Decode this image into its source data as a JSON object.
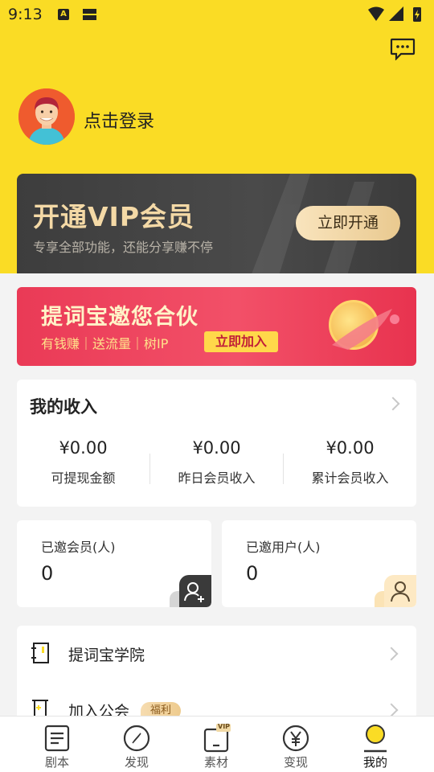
{
  "status_bar": {
    "time": "9:13",
    "notif_a": "A"
  },
  "header": {
    "login_text": "点击登录"
  },
  "vip": {
    "title": "开通VIP会员",
    "subtitle": "专享全部功能，还能分享赚不停",
    "button": "立即开通"
  },
  "partner_banner": {
    "title": "提词宝邀您合伙",
    "tags": "有钱赚｜送流量｜树IP",
    "button": "立即加入"
  },
  "income": {
    "title": "我的收入",
    "items": [
      {
        "value": "¥0.00",
        "label": "可提现金额"
      },
      {
        "value": "¥0.00",
        "label": "昨日会员收入"
      },
      {
        "value": "¥0.00",
        "label": "累计会员收入"
      }
    ]
  },
  "stats": [
    {
      "label": "已邀会员(人)",
      "value": "0"
    },
    {
      "label": "已邀用户(人)",
      "value": "0"
    }
  ],
  "menu": [
    {
      "label": "提词宝学院",
      "badge": ""
    },
    {
      "label": "加入公会",
      "badge": "福利"
    }
  ],
  "tabs": [
    {
      "label": "剧本"
    },
    {
      "label": "发现"
    },
    {
      "label": "素材",
      "badge": "VIP"
    },
    {
      "label": "变现"
    },
    {
      "label": "我的"
    }
  ],
  "colors": {
    "brand_yellow": "#fadc25",
    "vip_gold": "#f4d9a6",
    "banner_red": "#ea3a56"
  }
}
